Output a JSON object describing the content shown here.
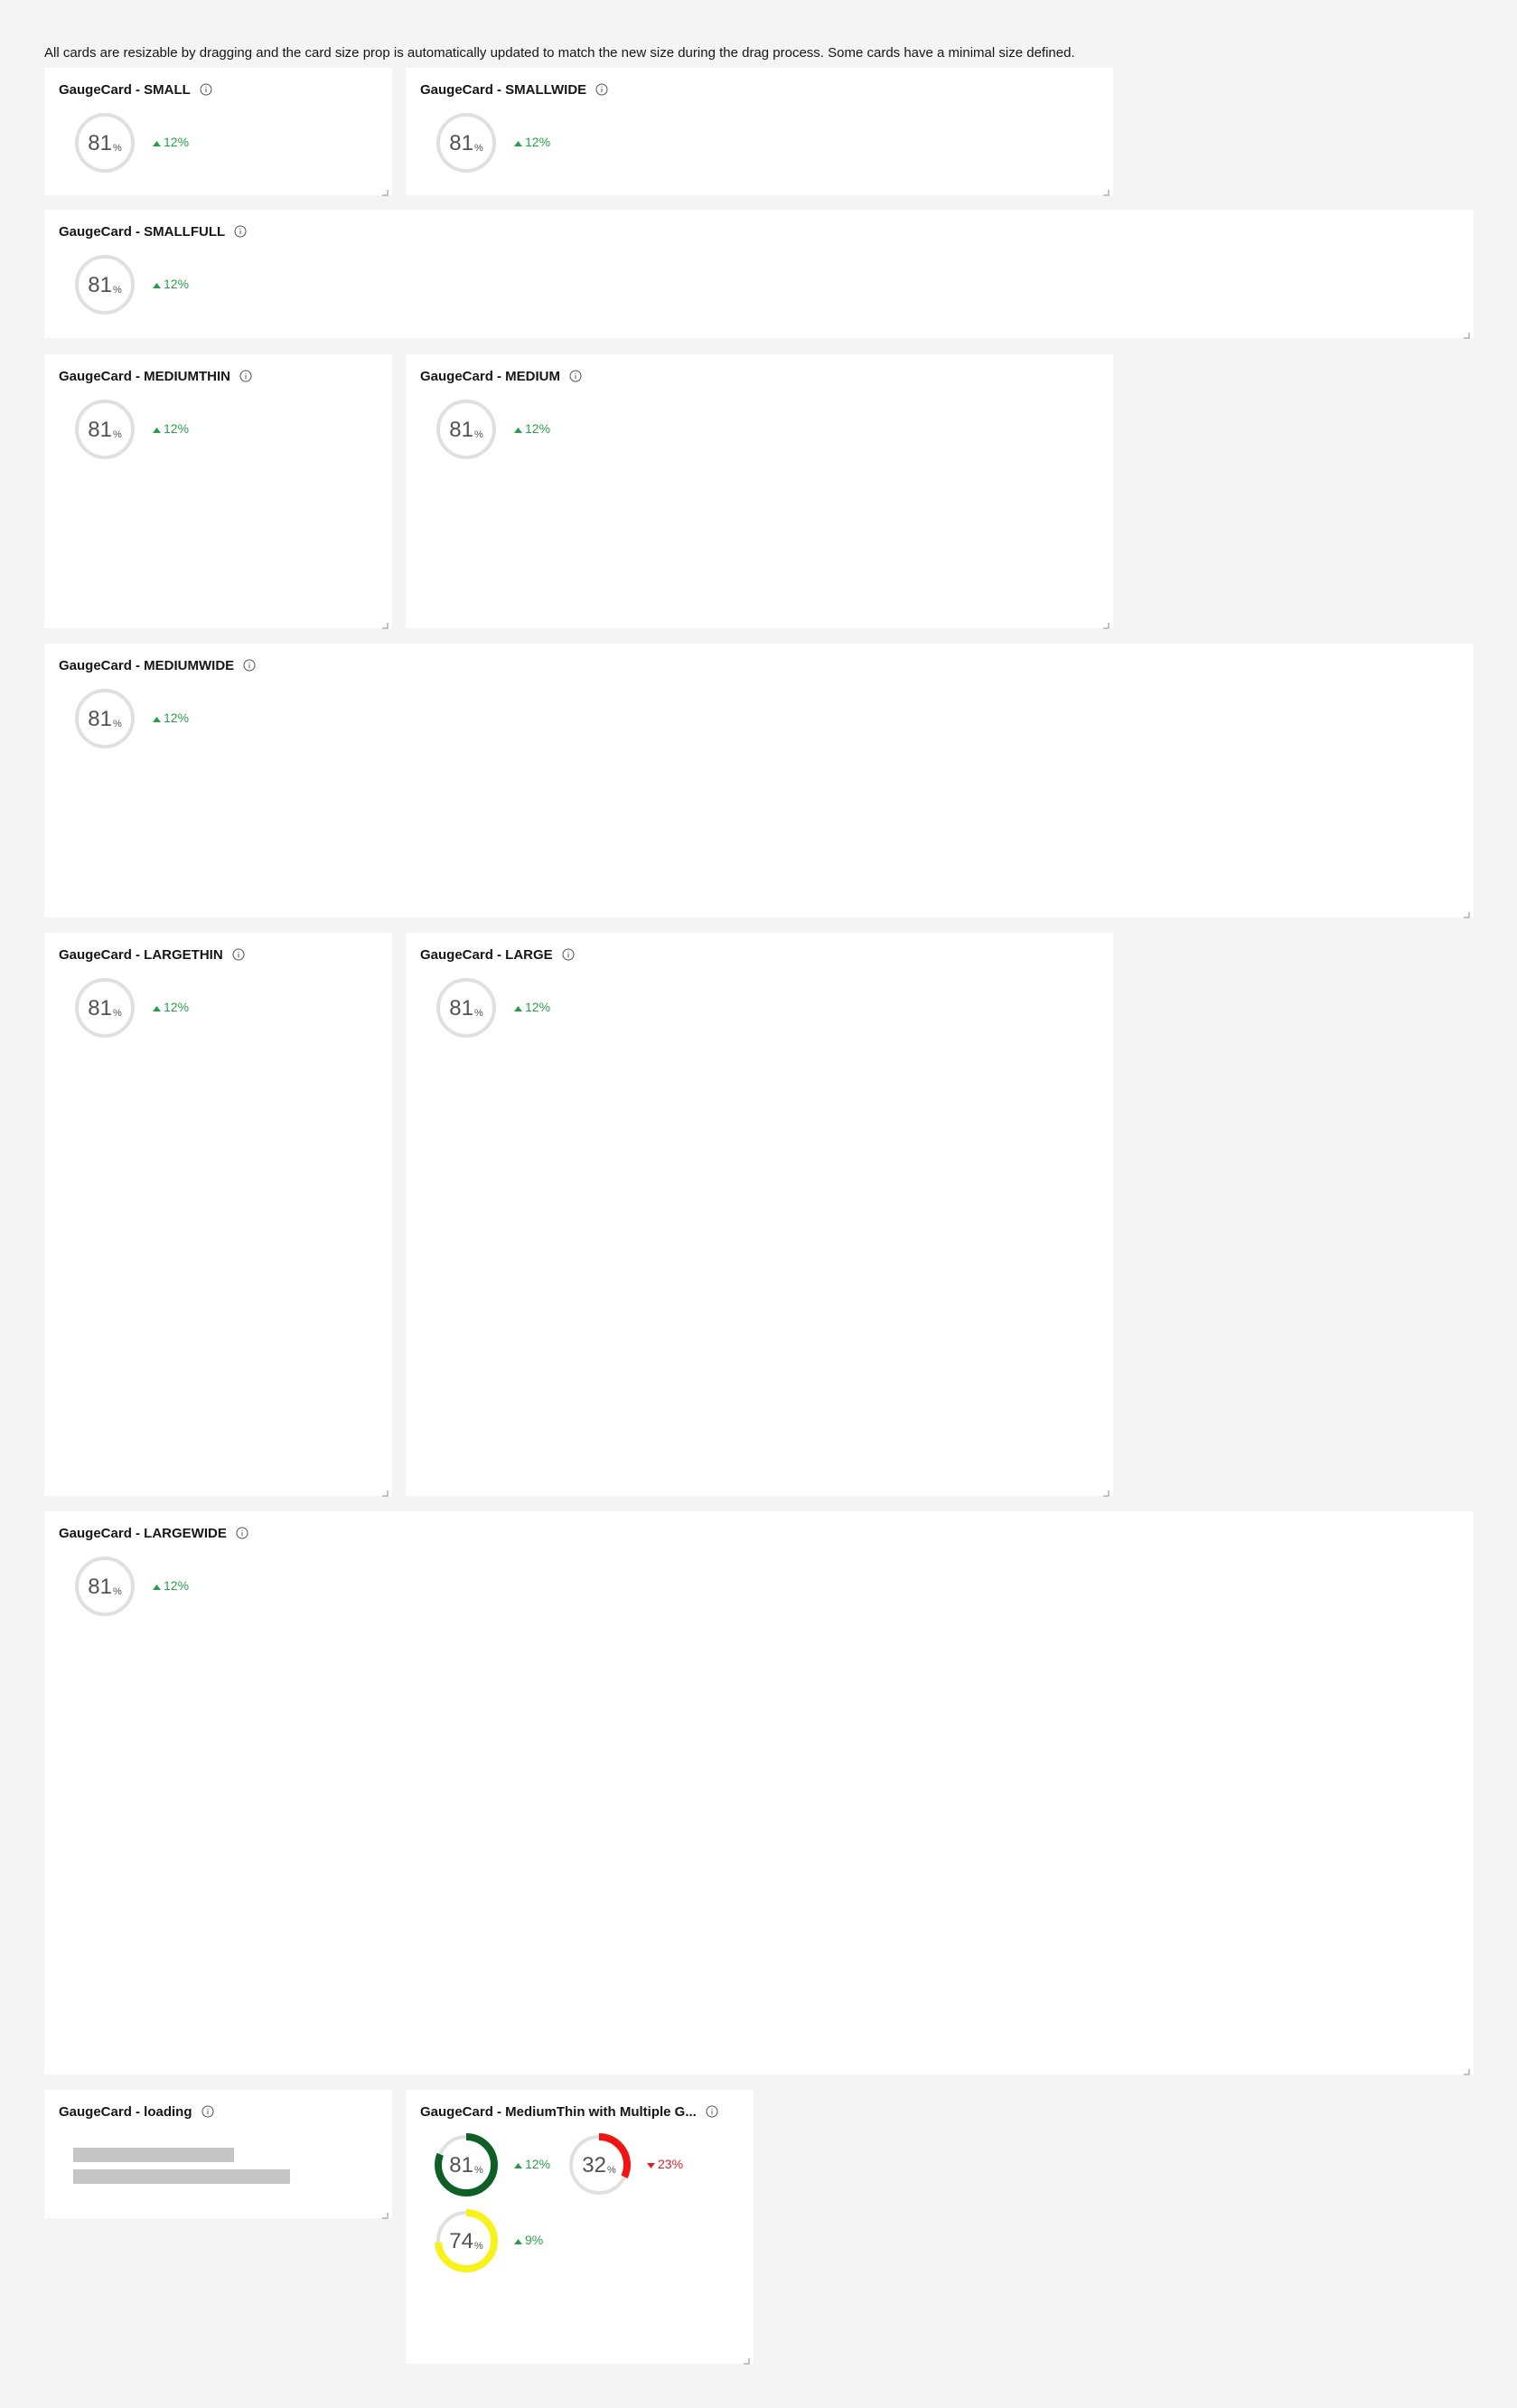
{
  "description": "All cards are resizable by dragging and the card size prop is automatically updated to match the new size during the drag process. Some cards have a minimal size defined.",
  "colors": {
    "page_background": "#f4f4f4",
    "card_background": "#ffffff",
    "trend_up": "#24a148",
    "trend_down": "#da1e28",
    "gauge_track": "#e0e0e0",
    "gauge_green": "#0e6027",
    "gauge_red": "#f01414",
    "gauge_yellow": "#f7f21b",
    "skeleton": "#c6c6c6"
  },
  "cards": [
    {
      "id": "small",
      "title": "GaugeCard - SMALL",
      "gauges": [
        {
          "value": "81",
          "unit": "%",
          "trend": "12%",
          "direction": "up",
          "fill": 0,
          "color": "none"
        }
      ]
    },
    {
      "id": "smallwide",
      "title": "GaugeCard - SMALLWIDE",
      "gauges": [
        {
          "value": "81",
          "unit": "%",
          "trend": "12%",
          "direction": "up",
          "fill": 0,
          "color": "none"
        }
      ]
    },
    {
      "id": "smallfull",
      "title": "GaugeCard - SMALLFULL",
      "gauges": [
        {
          "value": "81",
          "unit": "%",
          "trend": "12%",
          "direction": "up",
          "fill": 0,
          "color": "none"
        }
      ]
    },
    {
      "id": "mediumthin",
      "title": "GaugeCard - MEDIUMTHIN",
      "gauges": [
        {
          "value": "81",
          "unit": "%",
          "trend": "12%",
          "direction": "up",
          "fill": 0,
          "color": "none"
        }
      ]
    },
    {
      "id": "medium",
      "title": "GaugeCard - MEDIUM",
      "gauges": [
        {
          "value": "81",
          "unit": "%",
          "trend": "12%",
          "direction": "up",
          "fill": 0,
          "color": "none"
        }
      ]
    },
    {
      "id": "mediumwide",
      "title": "GaugeCard - MEDIUMWIDE",
      "gauges": [
        {
          "value": "81",
          "unit": "%",
          "trend": "12%",
          "direction": "up",
          "fill": 0,
          "color": "none"
        }
      ]
    },
    {
      "id": "largethin",
      "title": "GaugeCard - LARGETHIN",
      "gauges": [
        {
          "value": "81",
          "unit": "%",
          "trend": "12%",
          "direction": "up",
          "fill": 0,
          "color": "none"
        }
      ]
    },
    {
      "id": "large",
      "title": "GaugeCard - LARGE",
      "gauges": [
        {
          "value": "81",
          "unit": "%",
          "trend": "12%",
          "direction": "up",
          "fill": 0,
          "color": "none"
        }
      ]
    },
    {
      "id": "largewide",
      "title": "GaugeCard - LARGEWIDE",
      "gauges": [
        {
          "value": "81",
          "unit": "%",
          "trend": "12%",
          "direction": "up",
          "fill": 0,
          "color": "none"
        }
      ]
    },
    {
      "id": "loading",
      "title": "GaugeCard - loading",
      "loading": true,
      "gauges": []
    },
    {
      "id": "multiple",
      "title": "GaugeCard - MediumThin with Multiple G...",
      "gauges": [
        {
          "value": "81",
          "unit": "%",
          "trend": "12%",
          "direction": "up",
          "fill": 0.81,
          "color": "#0e6027"
        },
        {
          "value": "32",
          "unit": "%",
          "trend": "23%",
          "direction": "down",
          "fill": 0.32,
          "color": "#f01414"
        },
        {
          "value": "74",
          "unit": "%",
          "trend": "9%",
          "direction": "up",
          "fill": 0.74,
          "color": "#f7f21b"
        }
      ]
    }
  ]
}
